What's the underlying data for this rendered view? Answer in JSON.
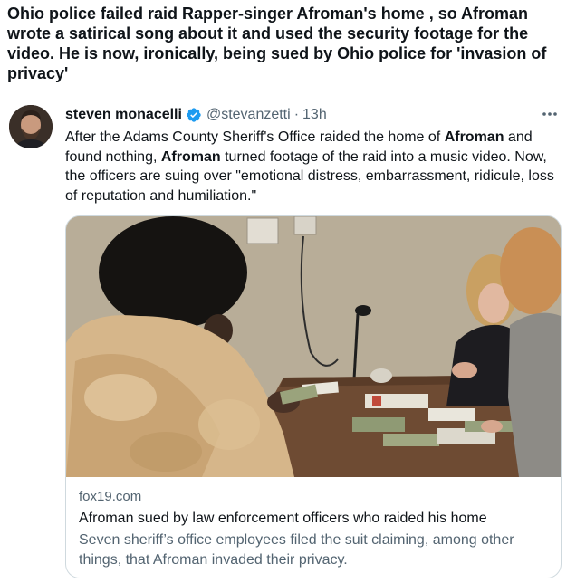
{
  "post": {
    "headline": "Ohio police failed raid Rapper-singer Afroman's home , so Afroman wrote a satirical song about it and used the security footage for the video. He is now, ironically, being sued by Ohio police for 'invasion of privacy'"
  },
  "tweet": {
    "author_name": "steven monacelli",
    "handle": "@stevanzetti",
    "separator": "·",
    "time": "13h",
    "verified_color": "#1d9bf0",
    "more_icon": "more-dots-icon",
    "body": {
      "part1": "After the Adams County Sheriff's Office raided the home of ",
      "bold1": "Afroman",
      "part2": " and found nothing, ",
      "bold2": "Afroman",
      "part3": " turned footage of the raid into a music video. Now, the officers are suing over \"emotional distress, embarrassment, ridicule, loss of reputation and humiliation.\""
    }
  },
  "card": {
    "domain": "fox19.com",
    "title": "Afroman sued by law enforcement officers who raided his home",
    "description": "Seven sheriff’s office employees filed the suit claiming, among other things, that Afroman invaded their privacy."
  }
}
